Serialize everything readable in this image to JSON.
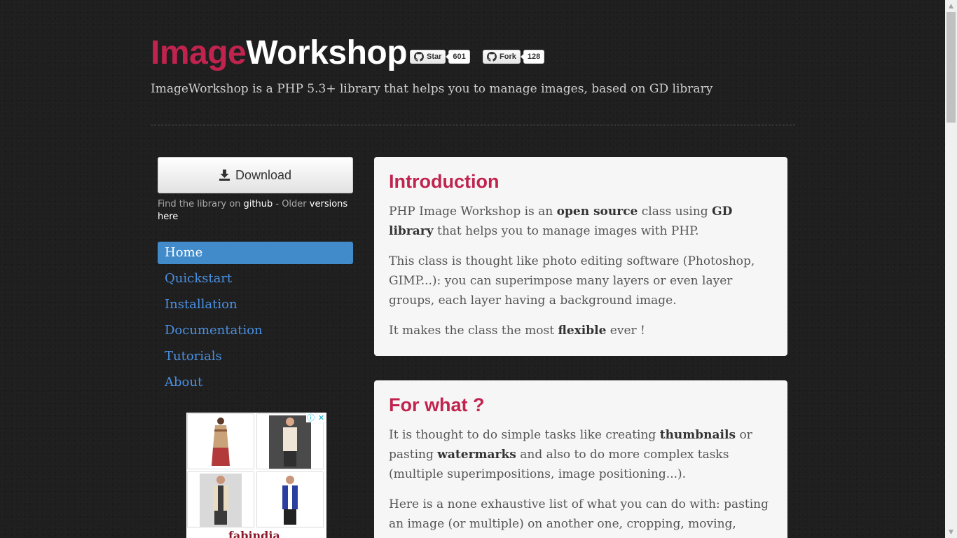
{
  "header": {
    "title_part1": "Image",
    "title_part2": "Workshop",
    "tagline": "ImageWorkshop is a PHP 5.3+ library that helps you to manage images, based on GD library"
  },
  "github_buttons": {
    "star_label": "Star",
    "star_count": "601",
    "fork_label": "Fork",
    "fork_count": "128"
  },
  "sidebar": {
    "download_label": "Download",
    "find_text_1": "Find the library on",
    "github_link": "github",
    "find_text_2": "- Older",
    "versions_link": "versions",
    "here_link": "here",
    "nav_items": [
      {
        "label": "Home",
        "active": true
      },
      {
        "label": "Quickstart"
      },
      {
        "label": "Installation"
      },
      {
        "label": "Documentation"
      },
      {
        "label": "Tutorials"
      },
      {
        "label": "About"
      }
    ]
  },
  "ad": {
    "info_icon": "ⓘ",
    "close_icon": "✕",
    "brand": "fabindia"
  },
  "sections": [
    {
      "title": "Introduction",
      "p1_a": "PHP Image Workshop is an",
      "p1_b": "open source",
      "p1_c": "class using",
      "p1_d": "GD library",
      "p1_e": "that helps you to manage images with PHP.",
      "p2": "This class is thought like photo editing software (Photoshop, GIMP...): you can superimpose many layers or even layer groups, each layer having a background image.",
      "p3_a": "It makes the class the most",
      "p3_b": "flexible",
      "p3_c": "ever !"
    },
    {
      "title": "For what ?",
      "p1_a": "It is thought to do simple tasks like creating",
      "p1_b": "thumbnails",
      "p1_c": "or pasting",
      "p1_d": "watermarks",
      "p1_e": "and also to do more complex tasks (multiple superimpositions, image positioning...).",
      "p2": "Here is a none exhaustive list of what you can do with: pasting an image (or multiple) on another one, cropping, moving, resizing,"
    }
  ],
  "colors": {
    "brand_red": "#c0244e",
    "nav_link": "#4a90e2",
    "nav_active_bg": "#428bca",
    "page_bg": "#1f1f1f"
  }
}
